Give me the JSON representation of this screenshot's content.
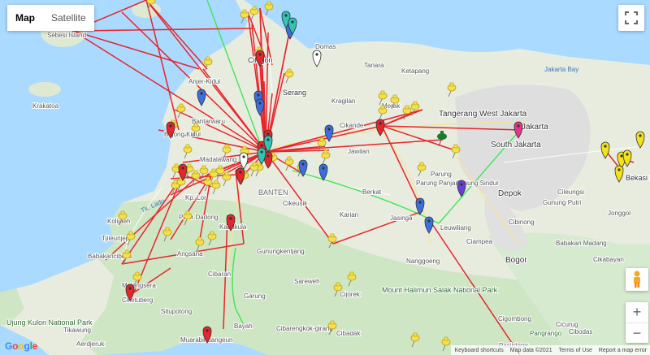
{
  "map_type": {
    "map": "Map",
    "satellite": "Satellite",
    "selected": "Map"
  },
  "labels": {
    "sebesi": "Sebesi Island",
    "krakatoa": "Krakatoa",
    "anjer": "Anjer-Kidul",
    "bantarwaru": "Bantarwaru",
    "bojong": "Bojong Kidul",
    "madalawang": "Madalawang",
    "kplor": "Kp. Lor",
    "banten": "BANTEN",
    "cikeusik": "Cikeusik",
    "jawilan": "Jawilan",
    "cikande": "Cikande",
    "kragilan": "Kragilan",
    "serang": "Serang",
    "cilegon": "Cilegon",
    "domas": "Domas",
    "tanara": "Tanara",
    "ketapang": "Ketapang",
    "merak": "Merak",
    "tangerang": "Tangerang",
    "west_jakarta": "West Jakarta",
    "jakarta": "Jakarta",
    "south_jakarta": "South Jakarta",
    "jakarta_bay": "Jakarta Bay",
    "depok": "Depok",
    "bogor": "Bogor",
    "bekasi": "Bekasi Regency",
    "gunung_putri": "Gunung Putri",
    "cileungsi": "Cileungsi",
    "jonggol": "Jonggol",
    "cibinong": "Cibinong",
    "cibubur": "Gunung Sindur",
    "parung": "Parung",
    "parung_panjang": "Parung Panjang",
    "jasinga": "Jasinga",
    "leuwiliang": "Leuwiliang",
    "ciampea": "Ciampea",
    "nanggoeng": "Nanggoeng",
    "karian": "Karian",
    "kadukula": "Kadukula",
    "pasir_dadong": "Pasir Dadong",
    "angsana": "Angsana",
    "cibaran": "Cibaran",
    "garung": "Garung",
    "gunungkentjang": "Gunungkentjang",
    "sareweh": "Sareweh",
    "cijorek": "Cijorek",
    "mount_halimun": "Mount Halimun Salak National Park",
    "cibarengkok": "Cibarengkok-girang",
    "cibadak": "Cibadak",
    "bayah": "Bayah",
    "ujung_kulon": "Ujung Kulon National Park",
    "tikawung": "Tikawung",
    "aerdjeruk": "Aerdjeruk",
    "cilletuberg": "Cilletuberg",
    "situpotong": "Situpotong",
    "muarabinuangeun": "Muarabinuangeun",
    "malangsera": "Malangsera",
    "babakancibeas": "Babakancibeas",
    "tjileunjep": "Tjileunjep",
    "kolijaeh": "Kolijaeh",
    "berkat": "Berkat",
    "cicurug": "Cicurug",
    "pangrango": "Pangrango",
    "cibodas": "Cibodas",
    "cigombong": "Cigombong",
    "cikabayan": "Cikabayan",
    "babakan_madang": "Babakan Madang",
    "pasirdater": "Pasirdater",
    "tk_ladu": "Tk. Ladu"
  },
  "icons": {
    "fullscreen": "fullscreen-icon",
    "pegman": "pegman-icon",
    "zoom_in": "zoom-in-icon",
    "zoom_out": "zoom-out-icon"
  },
  "zoom": {
    "in": "+",
    "out": "−"
  },
  "attribution": {
    "shortcuts": "Keyboard shortcuts",
    "data": "Map data ©2021",
    "terms": "Terms of Use",
    "error": "Report a map error"
  },
  "logo": "Google",
  "colors": {
    "sea": "#aadaff",
    "land": "#e8ecdf",
    "green_land": "#cfe6c4",
    "urban": "#dedede",
    "route_red": "#e8242c",
    "route_green": "#3ee655",
    "pin_yellow": "#f4e04d"
  }
}
